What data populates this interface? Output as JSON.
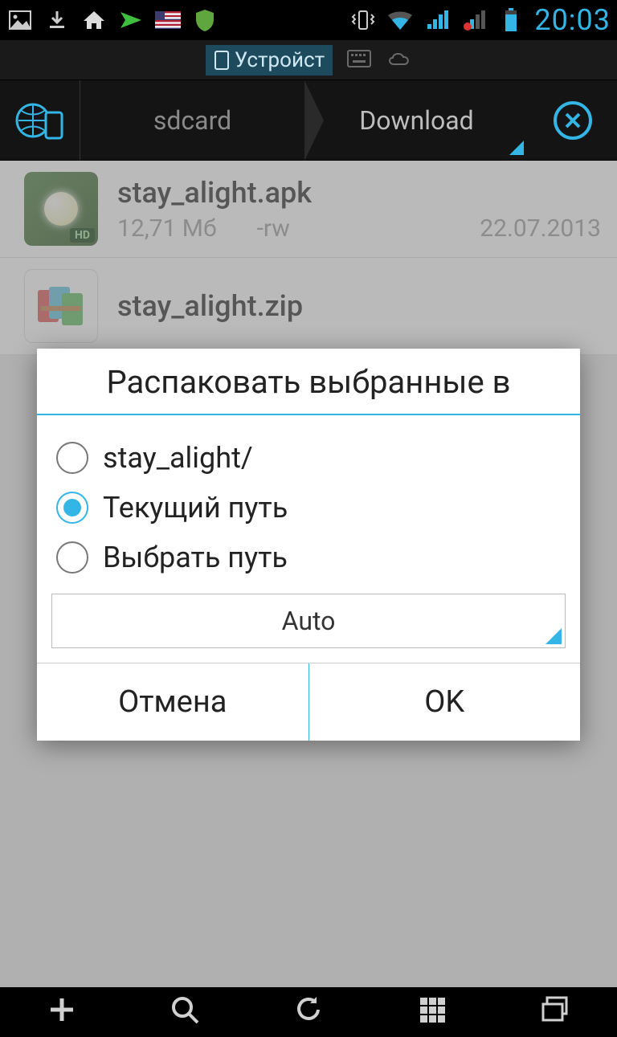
{
  "status": {
    "clock": "20:03"
  },
  "top_tabs": {
    "device": "Устройст"
  },
  "breadcrumb": {
    "item1": "sdcard",
    "item2": "Download"
  },
  "files": [
    {
      "name": "stay_alight.apk",
      "size": "12,71 Мб",
      "perm": "-rw",
      "date": "22.07.2013"
    },
    {
      "name": "stay_alight.zip"
    }
  ],
  "dialog": {
    "title": "Распаковать выбранные в",
    "options": [
      {
        "label": "stay_alight/",
        "selected": false
      },
      {
        "label": "Текущий путь",
        "selected": true
      },
      {
        "label": "Выбрать путь",
        "selected": false
      }
    ],
    "select": "Auto",
    "cancel": "Отмена",
    "ok": "OK"
  }
}
